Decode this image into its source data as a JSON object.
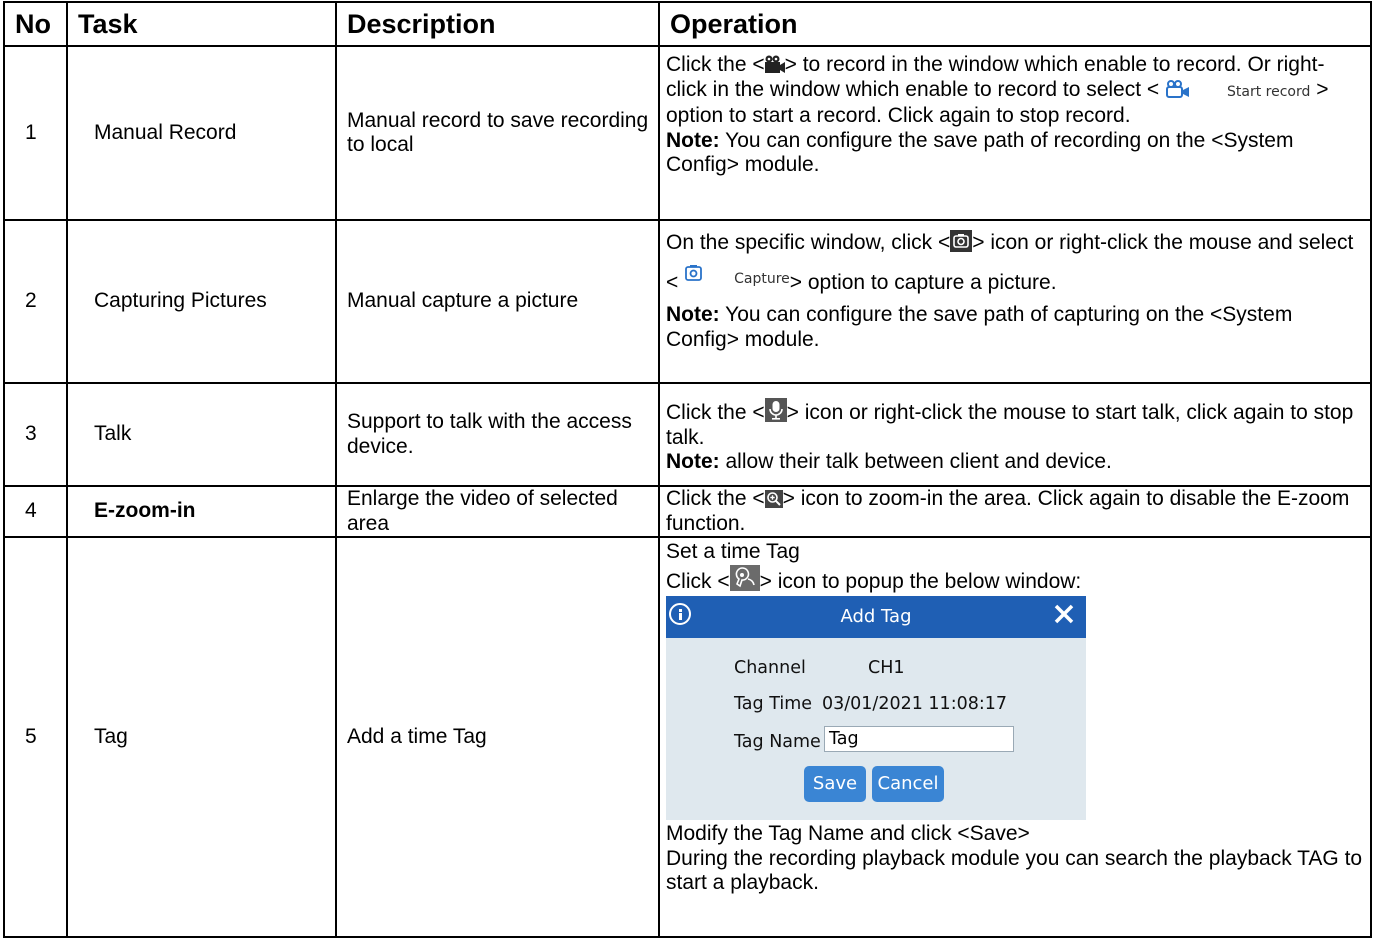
{
  "table": {
    "headers": [
      "No",
      "Task",
      "Description",
      "Operation"
    ],
    "rows": [
      {
        "no": "1",
        "task": "Manual Record",
        "description": "Manual record to save recording to local",
        "op": {
          "line1a": "Click the <",
          "line1b": "> to record in the window which enable to record. Or right-click in the window which enable to record to select < ",
          "inline_label": "Start record",
          "line1c": " > option to start a record. Click again to stop record.",
          "note_label": "Note:",
          "note_text": " You can configure the save path of recording on the <System Config> module."
        }
      },
      {
        "no": "2",
        "task": "Capturing Pictures",
        "description": "Manual capture a picture",
        "op": {
          "line1a": "On the specific window, click <",
          "line1b": "> icon or right-click the mouse and select < ",
          "inline_label": "Capture",
          "line1c": "> option to capture a picture.",
          "note_label": "Note:",
          "note_text": " You can configure the save path of capturing on the <System Config> module."
        }
      },
      {
        "no": "3",
        "task": "Talk",
        "description": "Support to talk with the access device.",
        "op": {
          "line1a": "Click the <",
          "line1b": "> icon or right-click the mouse to start talk, click again to stop talk.",
          "note_label": "Note:",
          "note_text": " allow their talk between client and device."
        }
      },
      {
        "no": "4",
        "task": "E-zoom-in",
        "description": "Enlarge the video of selected area",
        "op": {
          "line1a": "Click the <",
          "line1b": "> icon to zoom-in the area. Click again to disable the E-zoom function."
        }
      },
      {
        "no": "5",
        "task": "Tag",
        "description": "Add a time Tag",
        "op": {
          "line0": "Set a time Tag",
          "line1a": "Click <",
          "line1b": "> icon to popup the below window:",
          "after1": "Modify the Tag Name and click <Save>",
          "after2": "During the recording playback module you can search the playback TAG to start a playback."
        }
      }
    ]
  },
  "dialog": {
    "title": "Add Tag",
    "channel_label": "Channel",
    "channel_value": "CH1",
    "time_label": "Tag Time",
    "time_value": "03/01/2021 11:08:17",
    "name_label": "Tag Name",
    "name_value": "Tag",
    "save_label": "Save",
    "cancel_label": "Cancel"
  },
  "colors": {
    "dialog_header": "#1f5fb4",
    "dialog_body": "#dfe8ee",
    "button": "#3a85d4"
  },
  "icons": [
    "record-camera-icon",
    "video-record-icon",
    "camera-capture-icon",
    "capture-icon",
    "microphone-icon",
    "zoom-in-icon",
    "tag-icon",
    "info-icon",
    "close-icon"
  ]
}
